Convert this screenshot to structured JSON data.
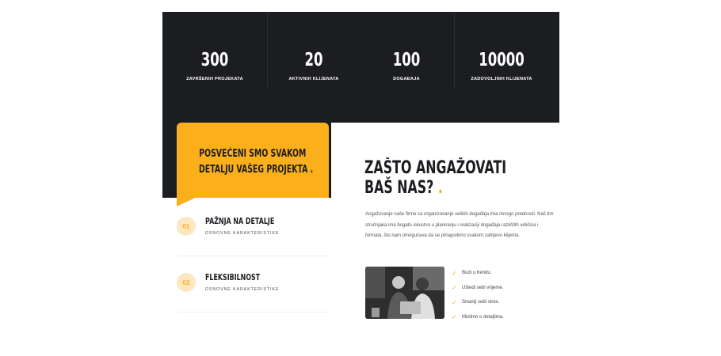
{
  "stats": [
    {
      "value": "300",
      "label": "ZAVRŠENIH PROJEKATA"
    },
    {
      "value": "20",
      "label": "AKTIVNIH KLIJENATA"
    },
    {
      "value": "100",
      "label": "DOGAĐAJA"
    },
    {
      "value": "10000",
      "label": "ZADOVOLJNIH KLIJENATA"
    }
  ],
  "highlight": {
    "line1": "POSVEĆENI SMO SVAKOM",
    "line2": "DETALJU VAŠEG PROJEKTA ."
  },
  "features": [
    {
      "badge": "01",
      "title": "PAŽNJA NA DETALJE",
      "subtitle": "OSNOVNE KARAKTERISTIKE"
    },
    {
      "badge": "02",
      "title": "FLEKSIBILNOST",
      "subtitle": "OSNOVNE KARAKTERISTIKE"
    }
  ],
  "why": {
    "heading_line1": "ZAŠTO ANGAŽOVATI",
    "heading_line2": "BAŠ NAS?",
    "heading_dot": ".",
    "paragraph": "Angažovanje naše firme za organizovanje velikih događaja ima mnogo prednosti. Naš tim stručnjaka ima bogato iskustvo u planiranju i realizaciji događaja različitih veličina i formata, što nam omogućava da se prilagodimo svakom zahtjevu klijenta.",
    "checklist": [
      "Budi u trendu.",
      "Uštedi sebi vrijeme.",
      "Smanji sebi stres.",
      "Mislimo o detaljima."
    ]
  },
  "colors": {
    "accent": "#fbaf1b",
    "dark": "#1c1d21"
  }
}
